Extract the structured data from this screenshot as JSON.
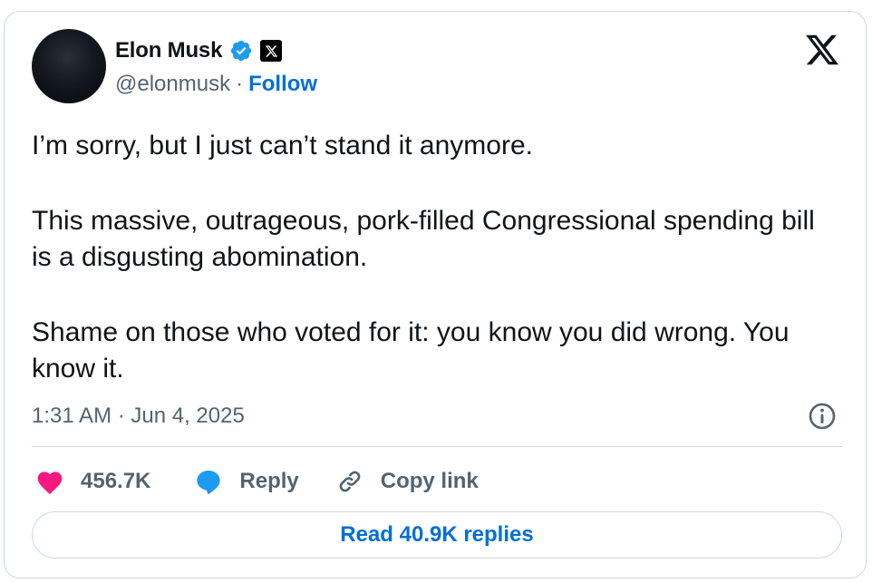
{
  "author": {
    "name": "Elon Musk",
    "handle": "@elonmusk",
    "separator": "·",
    "follow_label": "Follow",
    "verified_icon": "verified-badge-icon",
    "affiliation_icon": "x-badge-icon"
  },
  "platform_icon": "x-logo-icon",
  "tweet": {
    "paragraphs": [
      "I’m sorry, but I just can’t stand it anymore.",
      "This massive, outrageous, pork-filled Congressional spending bill is a disgusting abomination.",
      "Shame on those who voted for it: you know you did wrong. You know it."
    ],
    "timestamp": "1:31 AM · Jun 4, 2025"
  },
  "actions": {
    "like_count": "456.7K",
    "reply_label": "Reply",
    "copy_link_label": "Copy link"
  },
  "read_replies_label": "Read 40.9K replies",
  "colors": {
    "accent": "#006fd6",
    "verified": "#1d9bf0",
    "like": "#f91880",
    "text": "#0f1419",
    "muted": "#536471",
    "border": "#cfd9de"
  }
}
